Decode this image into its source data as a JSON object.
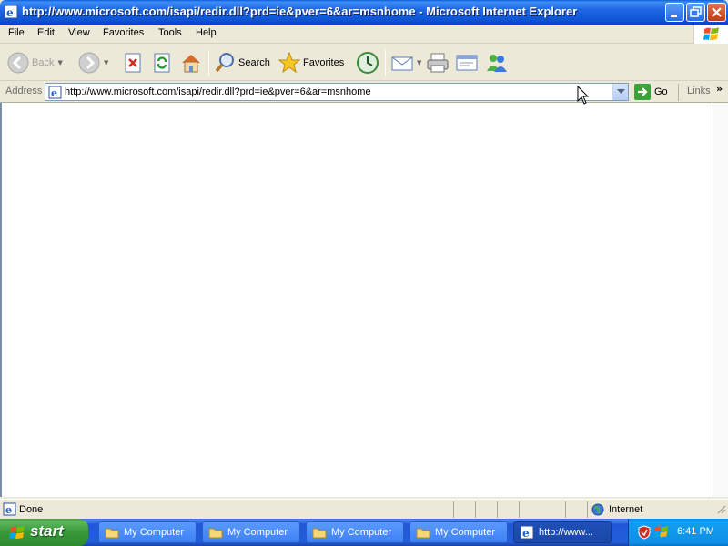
{
  "window": {
    "title": "http://www.microsoft.com/isapi/redir.dll?prd=ie&pver=6&ar=msnhome - Microsoft Internet Explorer"
  },
  "menu": [
    "File",
    "Edit",
    "View",
    "Favorites",
    "Tools",
    "Help"
  ],
  "toolbar": {
    "back_label": "Back",
    "search_label": "Search",
    "favorites_label": "Favorites"
  },
  "address": {
    "label": "Address",
    "url": "http://www.microsoft.com/isapi/redir.dll?prd=ie&pver=6&ar=msnhome",
    "go_label": "Go",
    "links_label": "Links"
  },
  "status": {
    "text": "Done",
    "zone": "Internet"
  },
  "taskbar": {
    "start_label": "start",
    "tasks": [
      "My Computer",
      "My Computer",
      "My Computer",
      "My Computer",
      "http://www..."
    ],
    "clock": "6:41 PM"
  },
  "colors": {
    "titlebar": "#0b52d1",
    "taskbar": "#245edb",
    "start_button": "#379837",
    "tray": "#0f8ee6"
  }
}
